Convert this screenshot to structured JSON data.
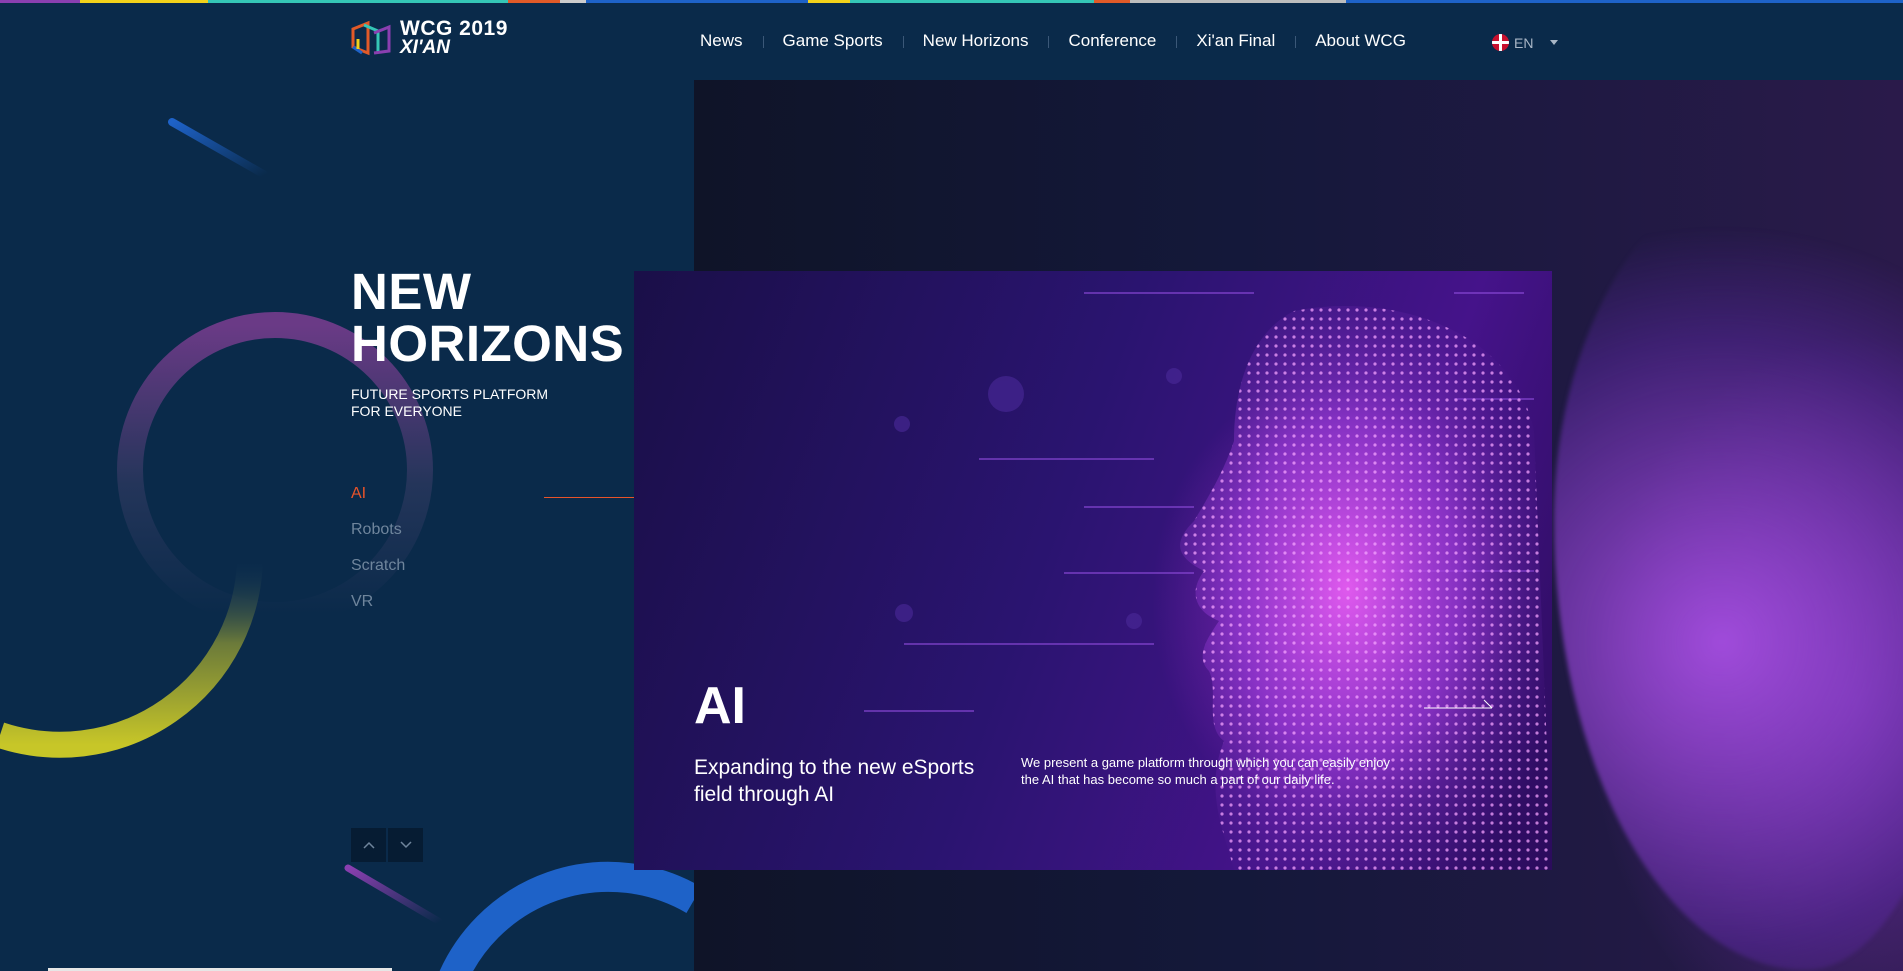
{
  "header": {
    "logo_title": "WCG 2019",
    "logo_sub": "XI'AN",
    "nav": [
      "News",
      "Game Sports",
      "New Horizons",
      "Conference",
      "Xi'an Final",
      "About WCG"
    ],
    "lang": "EN"
  },
  "hero": {
    "title_line1": "NEW",
    "title_line2": "HORIZONS",
    "subtitle": "FUTURE SPORTS PLATFORM FOR EVERYONE",
    "menu": [
      "AI",
      "Robots",
      "Scratch",
      "VR"
    ],
    "active_index": 0
  },
  "card": {
    "title": "AI",
    "subtitle": "Expanding to the new eSports field through AI",
    "description": "We present a game platform through which you can easily enjoy the AI that has become so much a part of our daily life."
  },
  "colors": {
    "bg": "#0a2a4a",
    "accent": "#e8542a",
    "card_purple": "#45138a"
  },
  "icons": {
    "logo": "wcg-logo-icon",
    "flag": "uk-flag-icon",
    "lang_caret": "chevron-down-icon",
    "up": "chevron-up-icon",
    "down": "chevron-down-icon",
    "card_arrow": "arrow-right-icon"
  }
}
